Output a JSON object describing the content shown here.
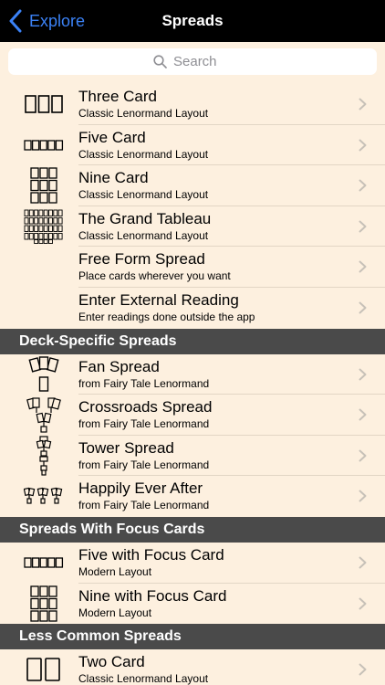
{
  "nav": {
    "back_label": "Explore",
    "title": "Spreads"
  },
  "search": {
    "placeholder": "Search"
  },
  "groups": [
    {
      "header": "",
      "items": [
        {
          "title": "Three Card",
          "subtitle": "Classic Lenormand Layout",
          "icon": "three-card-icon"
        },
        {
          "title": "Five Card",
          "subtitle": "Classic Lenormand Layout",
          "icon": "five-card-icon"
        },
        {
          "title": "Nine Card",
          "subtitle": "Classic Lenormand Layout",
          "icon": "nine-card-icon"
        },
        {
          "title": "The Grand Tableau",
          "subtitle": "Classic Lenormand Layout",
          "icon": "grand-tableau-icon"
        },
        {
          "title": "Free Form Spread",
          "subtitle": "Place cards wherever you want",
          "icon": ""
        },
        {
          "title": "Enter External Reading",
          "subtitle": "Enter readings done outside the app",
          "icon": ""
        }
      ]
    },
    {
      "header": "Deck-Specific Spreads",
      "items": [
        {
          "title": "Fan Spread",
          "subtitle": "from Fairy Tale Lenormand",
          "icon": "fan-spread-icon"
        },
        {
          "title": "Crossroads Spread",
          "subtitle": "from Fairy Tale Lenormand",
          "icon": "crossroads-spread-icon"
        },
        {
          "title": "Tower Spread",
          "subtitle": "from Fairy Tale Lenormand",
          "icon": "tower-spread-icon"
        },
        {
          "title": "Happily Ever After",
          "subtitle": "from Fairy Tale Lenormand",
          "icon": "happily-ever-after-icon"
        }
      ]
    },
    {
      "header": "Spreads With Focus Cards",
      "items": [
        {
          "title": "Five with Focus Card",
          "subtitle": "Modern Layout",
          "icon": "five-card-icon"
        },
        {
          "title": "Nine with Focus Card",
          "subtitle": "Modern Layout",
          "icon": "nine-card-icon"
        }
      ]
    },
    {
      "header": "Less Common Spreads",
      "items": [
        {
          "title": "Two Card",
          "subtitle": "Classic Lenormand Layout",
          "icon": "two-card-icon"
        }
      ]
    }
  ],
  "colors": {
    "background": "#fdf0df",
    "navbar": "#000000",
    "accent": "#3b82f6",
    "section_header": "#4a4a4a",
    "separator": "#e2d6c5",
    "chevron": "#c7c1b8"
  }
}
